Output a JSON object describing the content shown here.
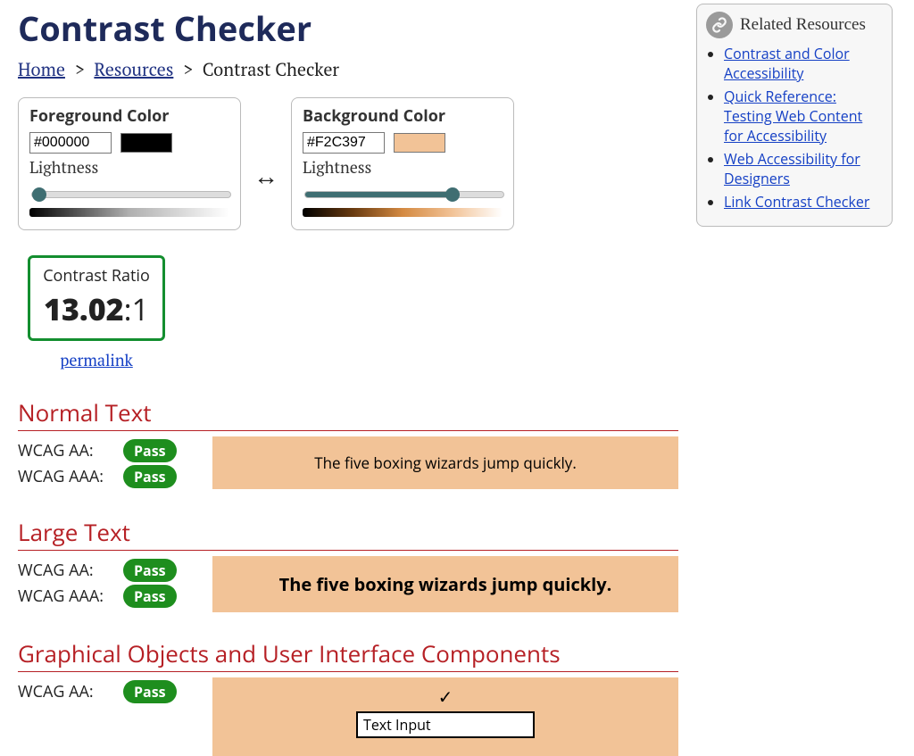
{
  "page": {
    "title": "Contrast Checker",
    "breadcrumb": {
      "home_label": "Home",
      "resources_label": "Resources",
      "current": "Contrast Checker",
      "sep": ">"
    }
  },
  "foreground": {
    "title": "Foreground Color",
    "hex": "#000000",
    "swatch_color": "#000000",
    "lightness_label": "Lightness",
    "lightness_value": 0,
    "gradient_css": "linear-gradient(to right, #000000, #b0b0b0, #ffffff)"
  },
  "background": {
    "title": "Background Color",
    "hex": "#F2C397",
    "swatch_color": "#F2C397",
    "lightness_label": "Lightness",
    "lightness_value": 76,
    "gradient_css": "linear-gradient(to right, #000000, #683a10, #d48a42, #f2c397, #ffffff)"
  },
  "swap_glyph": "↔",
  "ratio": {
    "label": "Contrast Ratio",
    "value_big": "13.02",
    "value_suffix": ":1",
    "permalink_label": "permalink"
  },
  "sections": {
    "normal": {
      "title": "Normal Text",
      "aa_label": "WCAG AA:",
      "aa_result": "Pass",
      "aaa_label": "WCAG AAA:",
      "aaa_result": "Pass",
      "sample": "The five boxing wizards jump quickly."
    },
    "large": {
      "title": "Large Text",
      "aa_label": "WCAG AA:",
      "aa_result": "Pass",
      "aaa_label": "WCAG AAA:",
      "aaa_result": "Pass",
      "sample": "The five boxing wizards jump quickly."
    },
    "ui": {
      "title": "Graphical Objects and User Interface Components",
      "aa_label": "WCAG AA:",
      "aa_result": "Pass",
      "check_glyph": "✓",
      "input_value": "Text Input"
    }
  },
  "sidebar": {
    "title": "Related Resources",
    "links": [
      "Contrast and Color Accessibility",
      "Quick Reference: Testing Web Content for Accessibility",
      "Web Accessibility for Designers",
      "Link Contrast Checker"
    ]
  },
  "colors": {
    "sample_bg": "#F2C397",
    "sample_fg": "#000000"
  }
}
